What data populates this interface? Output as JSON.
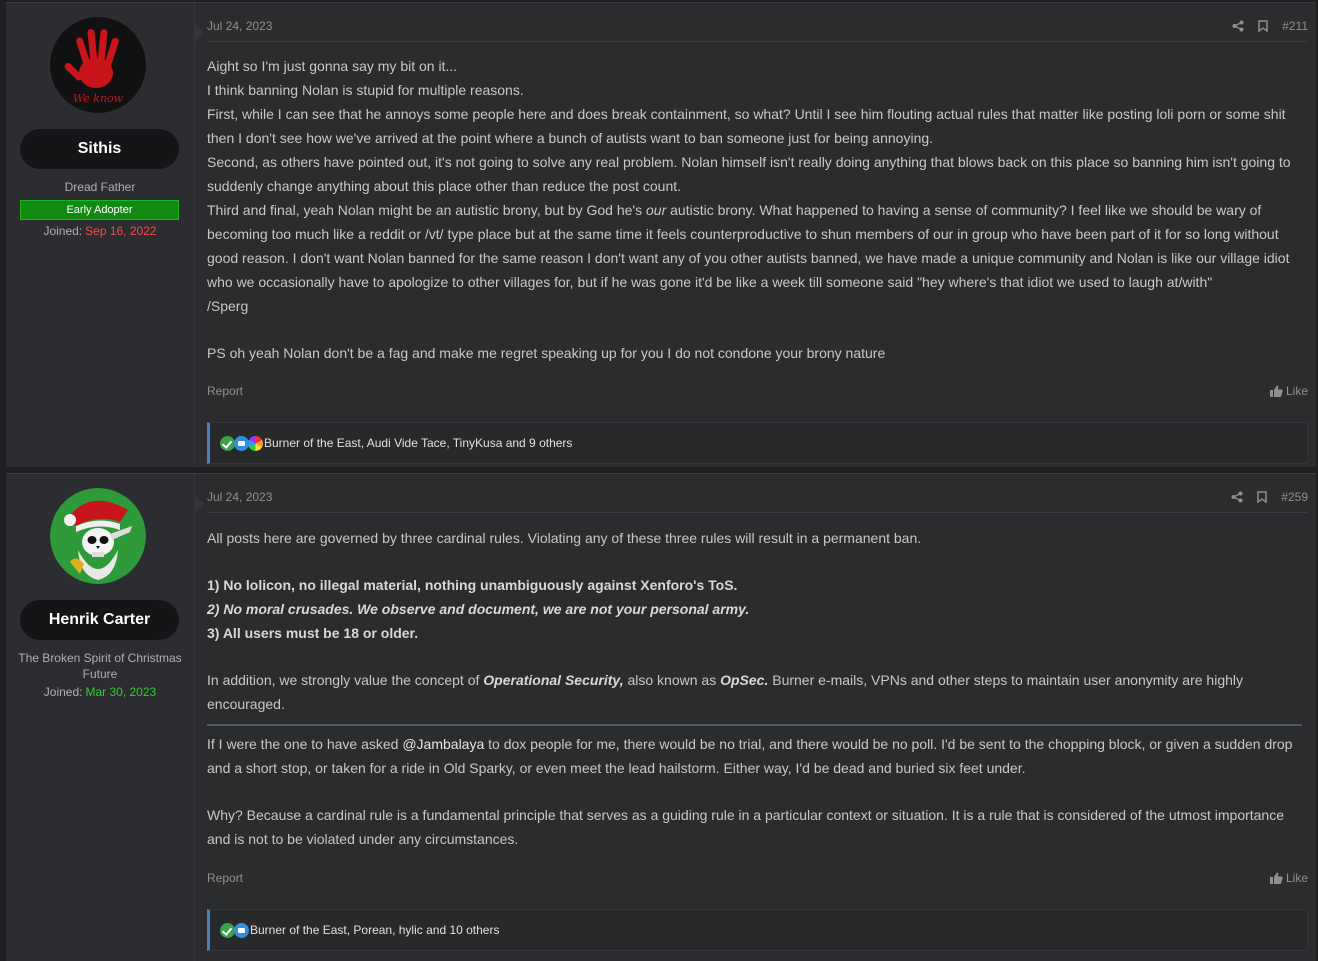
{
  "posts": [
    {
      "user": {
        "name": "Sithis",
        "title": "Dread Father",
        "banner": "Early Adopter",
        "joined_label": "Joined:",
        "joined_date": "Sep 16, 2022",
        "avatar_icon": "red-hand-icon",
        "avatar_text": "We know"
      },
      "date": "Jul 24, 2023",
      "number": "#211",
      "paragraphs": [
        "Aight so I'm just gonna say my bit on it...",
        "I think banning Nolan is stupid for multiple reasons.",
        "First, while I can see that he annoys some people here and does break containment, so what? Until I see him flouting actual rules that matter like posting loli porn or some shit then I don't see how we've arrived at the point where a bunch of autists want to ban someone just for being annoying.",
        "Second, as others have pointed out, it's not going to solve any real problem. Nolan himself isn't really doing anything that blows back on this place so banning him isn't going to suddenly change anything about this place other than reduce the post count."
      ],
      "third_pre": "Third and final, yeah Nolan might be an autistic brony, but by God he's ",
      "third_em": "our",
      "third_post": " autistic brony. What happened to having a sense of community? I feel like we should be wary of becoming too much like a reddit or /vt/ type place but at the same time it feels counterproductive to shun members of our in group who have been part of it for so long without good reason. I don't want Nolan banned for the same reason I don't want any of you other autists banned, we have made a unique community and Nolan is like our village idiot who we occasionally have to apologize to other villages for, but if he was gone it'd be like a week till someone said \"hey where's that idiot we used to laugh at/with\"",
      "sign": "/Sperg",
      "ps": "PS oh yeah Nolan don't be a fag and make me regret speaking up for you I do not condone your brony nature",
      "report_label": "Report",
      "like_label": "Like",
      "reactions": "Burner of the East, Audi Vide Tace, TinyKusa and 9 others"
    },
    {
      "user": {
        "name": "Henrik Carter",
        "title": "The Broken Spirit of Christmas Future",
        "joined_label": "Joined:",
        "joined_date": "Mar 30, 2023",
        "avatar_icon": "santa-skull-icon"
      },
      "date": "Jul 24, 2023",
      "number": "#259",
      "intro": "All posts here are governed by three cardinal rules. Violating any of these three rules will result in a permanent ban.",
      "rule1": "1) No lolicon, no illegal material, nothing unambiguously against Xenforo's ToS.",
      "rule2": "2) No moral crusades. We observe and document, we are not your personal army.",
      "rule3": "3) All users must be 18 or older.",
      "opsec_pre": "In addition, we strongly value the concept of ",
      "opsec_em1": "Operational Security,",
      "opsec_mid": " also known as ",
      "opsec_em2": "OpSec.",
      "opsec_post": " Burner e-mails, VPNs and other steps to maintain user anonymity are highly encouraged.",
      "reply_pre": "If I were the one to have asked ",
      "reply_mention": "@Jambalaya",
      "reply_post": " to dox people for me, there would be no trial, and there would be no poll. I'd be sent to the chopping block, or given a sudden drop and a short stop, or taken for a ride in Old Sparky, or even meet the lead hailstorm. Either way, I'd be dead and buried six feet under.",
      "why": "Why? Because a cardinal rule is a fundamental principle that serves as a guiding rule in a particular context or situation. It is a rule that is considered of the utmost importance and is not to be violated under any circumstances.",
      "report_label": "Report",
      "like_label": "Like",
      "reactions": "Burner of the East, Porean, hylic and 10 others"
    }
  ],
  "colors": {
    "joined_date_1": "#ff4444",
    "joined_date_2": "#33cc33",
    "banner_bg": "#108a10",
    "reaction_accent": "#4d7fbf"
  }
}
